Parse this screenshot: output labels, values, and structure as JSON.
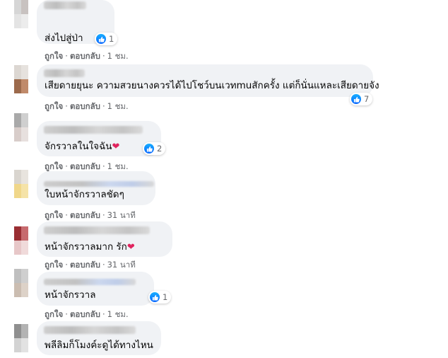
{
  "comments": [
    {
      "text": "ส่งไปสู่ป่า",
      "heart": false,
      "reactions": "1",
      "actions": {
        "like": "ถูกใจ",
        "reply": "ตอบกลับ",
        "time": "1 ชม."
      },
      "avatar_colors": [
        "#d6d6d6",
        "#c8c2c0",
        "#e4e4e4",
        "#ececec"
      ]
    },
    {
      "text": "เสียดายยุนะ ความสวยนางควรได้ไปโชว์บนเวทmuสักครั้ง แต่ก็นั่นแหละเสียดายจัง",
      "heart": false,
      "reactions": "7",
      "actions": {
        "like": "ถูกใจ",
        "reply": "ตอบกลับ",
        "time": "1 ชม."
      },
      "avatar_colors": [
        "#dcd7d2",
        "#e6e2de",
        "#9c6a4c",
        "#c08a6a"
      ]
    },
    {
      "text": "จักรวาลในใจฉัน",
      "heart": true,
      "reactions": "2",
      "actions": {
        "like": "ถูกใจ",
        "reply": "ตอบกลับ",
        "time": "1 ชม."
      },
      "avatar_colors": [
        "#a9a9a9",
        "#cfcfcf",
        "#d8cdca",
        "#e7e0de"
      ]
    },
    {
      "text": "ใบหน้าจักรวาลชัดๆ",
      "heart": false,
      "reactions": "",
      "actions": {
        "like": "ถูกใจ",
        "reply": "ตอบกลับ",
        "time": "31 นาที"
      },
      "avatar_colors": [
        "#d9d5cf",
        "#e8e4de",
        "#f0d78a",
        "#f5e3a8"
      ]
    },
    {
      "text": "หน้าจักรวาลมาก รัก",
      "heart": true,
      "reactions": "",
      "actions": {
        "like": "ถูกใจ",
        "reply": "ตอบกลับ",
        "time": "31 นาที"
      },
      "avatar_colors": [
        "#9a2e33",
        "#c76a6e",
        "#e7c7c8",
        "#f0dada"
      ]
    },
    {
      "text": "หน้าจักรวาล",
      "heart": false,
      "reactions": "1",
      "actions": {
        "like": "ถูกใจ",
        "reply": "ตอบกลับ",
        "time": "1 ชม."
      },
      "avatar_colors": [
        "#bfbfbf",
        "#cfcfcf",
        "#cbbdb1",
        "#ddd2c8"
      ]
    },
    {
      "text": "พลีลิมก็โมงค์ะดูได้ทางไหน",
      "heart": false,
      "reactions": "",
      "actions": {
        "like": "",
        "reply": "",
        "time": ""
      },
      "avatar_colors": [
        "#8f8f8f",
        "#b3b3b3",
        "#d3d3d3",
        "#e2e2e2"
      ]
    }
  ]
}
